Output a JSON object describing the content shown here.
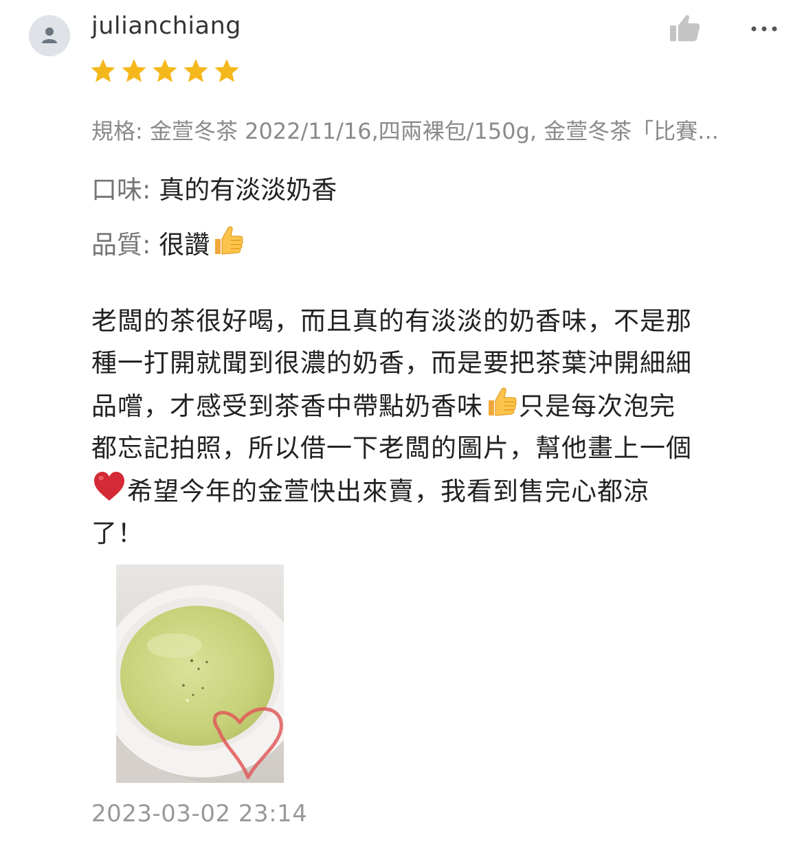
{
  "review": {
    "username": "julianchiang",
    "avatar_icon": "user-silhouette-icon",
    "rating": 5,
    "max_rating": 5,
    "star_color": "#F5B81C",
    "spec_label": "規格:",
    "spec_value": "金萱冬茶 2022/11/16,四兩裸包/150g, 金萱冬茶「比賽...",
    "taste_label": "口味:",
    "taste_value": "真的有淡淡奶香",
    "quality_label": "品質:",
    "quality_value": "很讚",
    "quality_emoji": "thumbs-up-emoji",
    "body_lines": [
      {
        "text": "老闆的茶很好喝，而且真的有淡淡的奶香味，不是那"
      },
      {
        "text": "種一打開就聞到很濃的奶香，而是要把茶葉沖開細細"
      },
      {
        "text_before": "品嚐，才感受到茶香中帶點奶香味",
        "emoji": "thumbs-up-emoji",
        "text_after": "只是每次泡完"
      },
      {
        "text": "都忘記拍照，所以借一下老闆的圖片，幫他畫上一個"
      },
      {
        "emoji": "red-heart-emoji",
        "text_after": "希望今年的金萱快出來賣，我看到售完心都涼"
      },
      {
        "text": "了！"
      }
    ],
    "photo_description_icon": "tea-cup-photo",
    "timestamp": "2023-03-02 23:14"
  },
  "actions": {
    "like_icon": "thumbs-up-icon",
    "more_icon": "more-options-icon"
  }
}
